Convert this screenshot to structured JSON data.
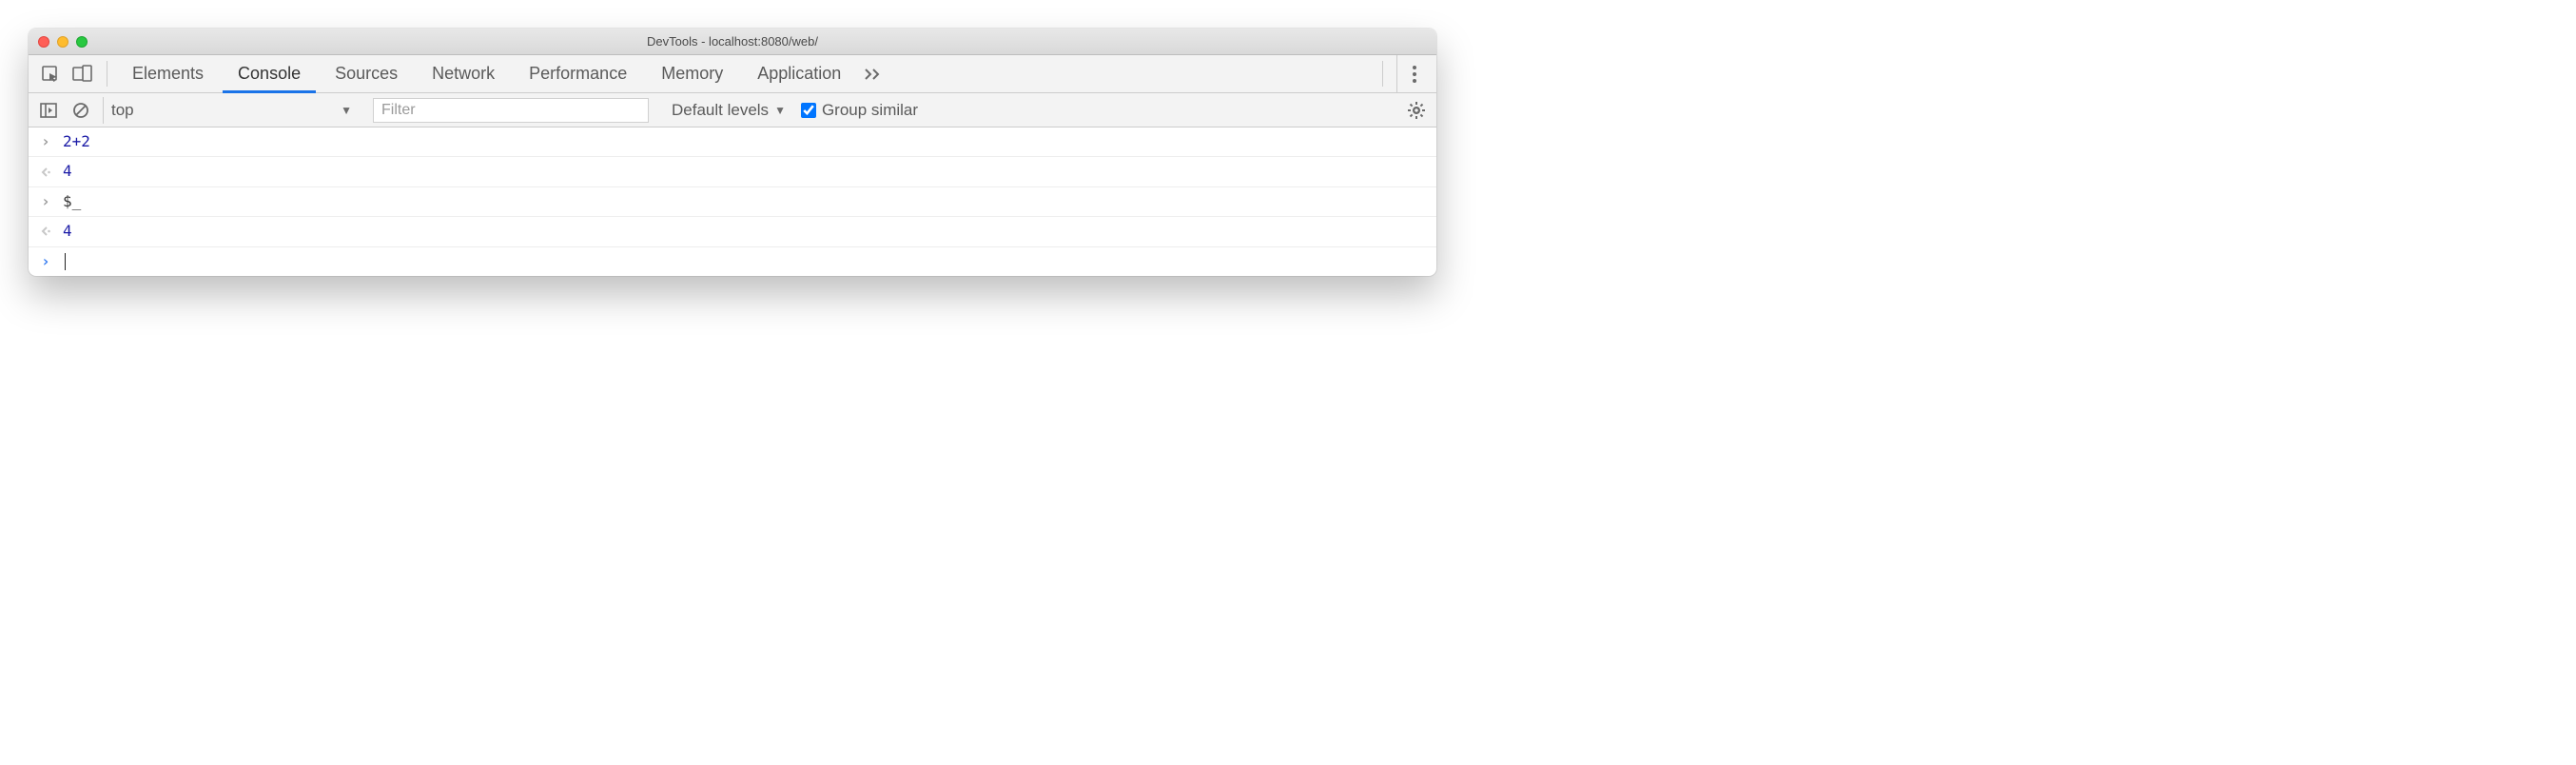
{
  "window": {
    "title": "DevTools - localhost:8080/web/"
  },
  "tabs": {
    "items": [
      "Elements",
      "Console",
      "Sources",
      "Network",
      "Performance",
      "Memory",
      "Application"
    ],
    "active_index": 1
  },
  "toolbar": {
    "context": "top",
    "filter_placeholder": "Filter",
    "filter_value": "",
    "levels_label": "Default levels",
    "group_similar_label": "Group similar",
    "group_similar_checked": true
  },
  "console_rows": [
    {
      "kind": "input",
      "tokens": [
        {
          "t": "2",
          "c": "num"
        },
        {
          "t": "+",
          "c": "op"
        },
        {
          "t": "2",
          "c": "num"
        }
      ]
    },
    {
      "kind": "output",
      "tokens": [
        {
          "t": "4",
          "c": "num"
        }
      ]
    },
    {
      "kind": "input",
      "tokens": [
        {
          "t": "$_",
          "c": "var"
        }
      ]
    },
    {
      "kind": "output",
      "tokens": [
        {
          "t": "4",
          "c": "num"
        }
      ]
    },
    {
      "kind": "prompt",
      "tokens": []
    }
  ]
}
